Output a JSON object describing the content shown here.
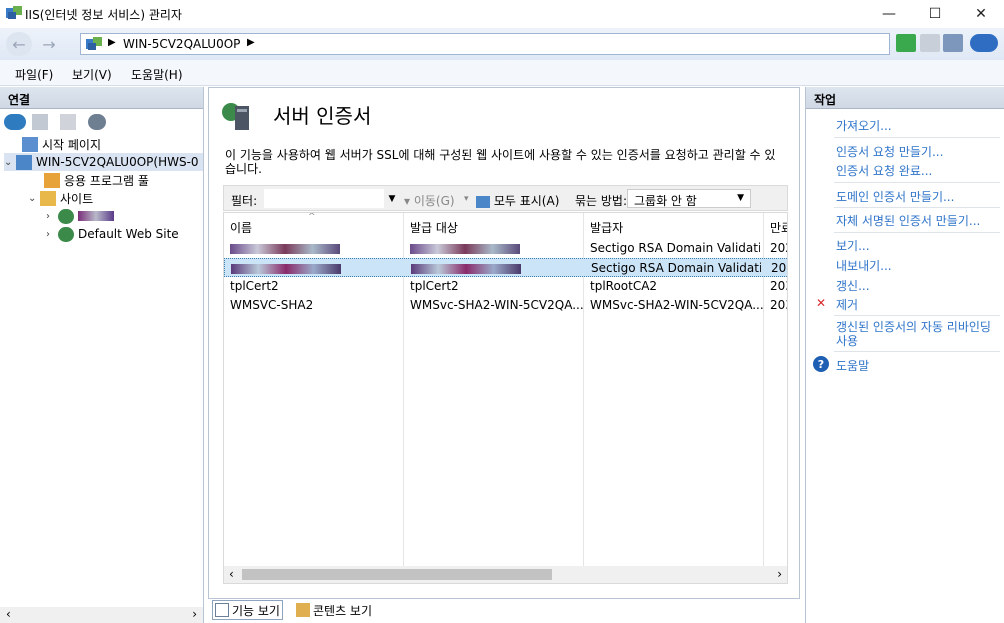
{
  "window": {
    "title": "IIS(인터넷 정보 서비스) 관리자",
    "minimize": "—",
    "maximize": "☐",
    "close": "✕"
  },
  "address": {
    "back": "←",
    "forward": "→",
    "path": "WIN-5CV2QALU0OP",
    "separator": "▶"
  },
  "menu": {
    "file": "파일(F)",
    "view": "보기(V)",
    "help": "도움말(H)"
  },
  "connections": {
    "header": "연결",
    "tree": {
      "start_page": "시작 페이지",
      "server": "WIN-5CV2QALU0OP(HWS-0",
      "app_pools": "응용 프로그램 풀",
      "sites": "사이트",
      "default_site": "Default Web Site"
    }
  },
  "center": {
    "title": "서버 인증서",
    "description": "이 기능을 사용하여 웹 서버가 SSL에 대해 구성된 웹 사이트에 사용할 수 있는 인증서를 요청하고 관리할 수 있습니다.",
    "filter_label": "필터:",
    "go_label": "이동(G)",
    "show_all_label": "모두 표시(A)",
    "group_label": "묶는 방법:",
    "group_value": "그룹화 안 함",
    "columns": [
      "이름",
      "발급 대상",
      "발급자",
      "만료"
    ],
    "rows": [
      {
        "name": "",
        "issued_to": "",
        "issued_by": "Sectigo RSA Domain Validati...",
        "expires": "202"
      },
      {
        "name": "",
        "issued_to": "",
        "issued_by": "Sectigo RSA Domain Validati...",
        "expires": "202"
      },
      {
        "name": "tplCert2",
        "issued_to": "tplCert2",
        "issued_by": "tplRootCA2",
        "expires": "203"
      },
      {
        "name": "WMSVC-SHA2",
        "issued_to": "WMSvc-SHA2-WIN-5CV2QA...",
        "issued_by": "WMSvc-SHA2-WIN-5CV2QA...",
        "expires": "203"
      }
    ],
    "tabs": {
      "features": "기능 보기",
      "content": "콘텐츠 보기"
    }
  },
  "actions": {
    "header": "작업",
    "import": "가져오기...",
    "create_request": "인증서 요청 만들기...",
    "complete_request": "인증서 요청 완료...",
    "create_domain": "도메인 인증서 만들기...",
    "create_self_signed": "자체 서명된 인증서 만들기...",
    "view": "보기...",
    "export": "내보내기...",
    "renew": "갱신...",
    "remove": "제거",
    "auto_rebind": "갱신된 인증서의 자동 리바인딩 사용",
    "help": "도움말"
  },
  "colors": {
    "link": "#2f74c9",
    "selection": "#cce4f7",
    "remove_icon": "#d92b2b",
    "help_icon": "#1e5fb4"
  }
}
